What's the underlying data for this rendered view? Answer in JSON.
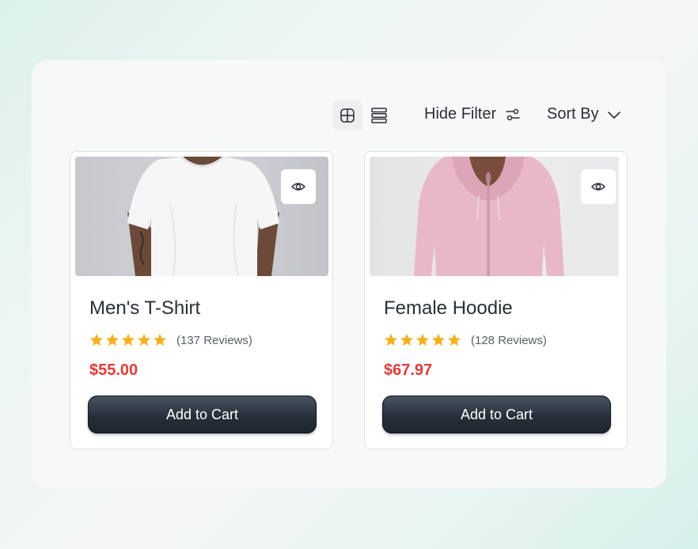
{
  "toolbar": {
    "grid_view_icon": "grid-icon",
    "list_view_icon": "list-icon",
    "hide_filter_label": "Hide Filter",
    "sort_by_label": "Sort By"
  },
  "products": [
    {
      "title": "Men's T-Shirt",
      "rating": 5,
      "reviews": "(137 Reviews)",
      "price": "$55.00",
      "button_label": "Add to Cart",
      "image_desc_icon": "t-shirt-image"
    },
    {
      "title": "Female Hoodie",
      "rating": 5,
      "reviews": "(128 Reviews)",
      "price": "$67.97",
      "button_label": "Add to Cart",
      "image_desc_icon": "hoodie-image"
    }
  ],
  "colors": {
    "price": "#e23b36",
    "star": "#f6b01e",
    "button": "#27303a"
  }
}
